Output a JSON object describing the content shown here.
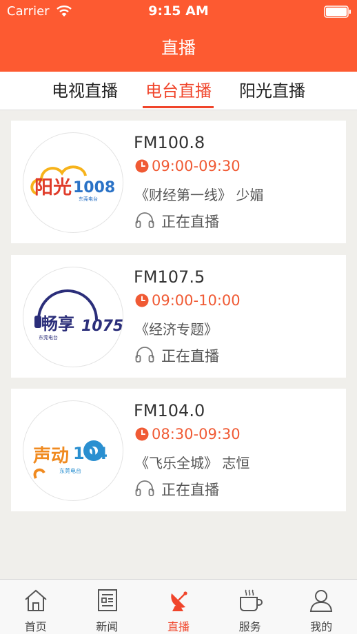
{
  "status_bar": {
    "carrier": "Carrier",
    "time": "9:15 AM"
  },
  "header": {
    "title": "直播"
  },
  "tabs": [
    {
      "label": "电视直播"
    },
    {
      "label": "电台直播"
    },
    {
      "label": "阳光直播"
    }
  ],
  "active_tab": "电台直播",
  "stations": [
    {
      "freq": "FM100.8",
      "time": "09:00-09:30",
      "program": "《财经第一线》 少媚",
      "status": "正在直播",
      "logo_text": "阳光",
      "logo_number": "1008",
      "logo_caption": "东莞电台"
    },
    {
      "freq": "FM107.5",
      "time": "09:00-10:00",
      "program": "《经济专题》",
      "status": "正在直播",
      "logo_text": "畅享",
      "logo_number": "1075",
      "logo_caption": "东莞电台"
    },
    {
      "freq": "FM104.0",
      "time": "08:30-09:30",
      "program": "《飞乐全城》 志恒",
      "status": "正在直播",
      "logo_text": "声动",
      "logo_number": "104",
      "logo_caption": "东莞电台"
    }
  ],
  "tabbar": [
    {
      "label": "首页",
      "icon": "home-icon"
    },
    {
      "label": "新闻",
      "icon": "news-icon"
    },
    {
      "label": "直播",
      "icon": "satellite-dish-icon"
    },
    {
      "label": "服务",
      "icon": "coffee-cup-icon"
    },
    {
      "label": "我的",
      "icon": "user-icon"
    }
  ],
  "colors": {
    "brand": "#fd5a31",
    "accent": "#f0452b",
    "time": "#f05a34"
  }
}
